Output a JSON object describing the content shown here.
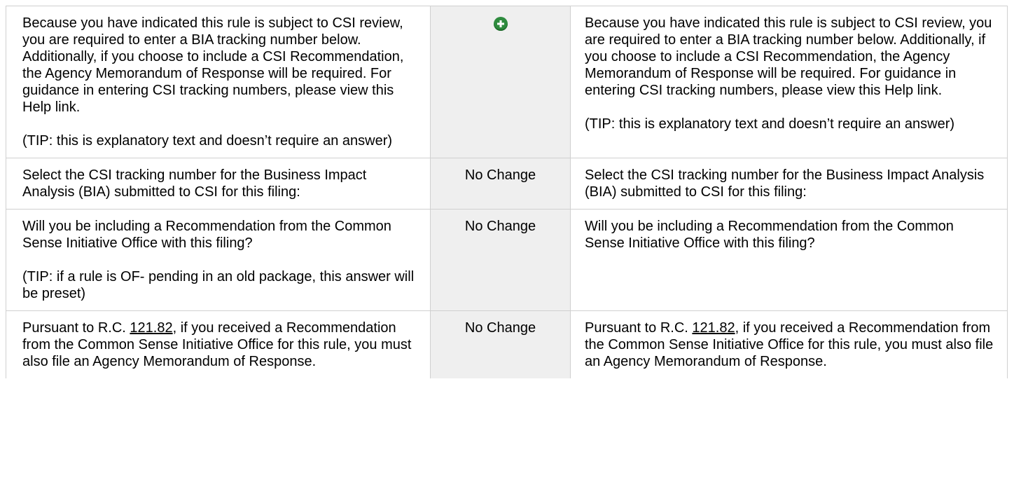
{
  "rows": [
    {
      "before": {
        "paragraphs": [
          "Because you have indicated this rule is subject to CSI review, you are required to enter a BIA tracking number below. Additionally, if you choose to include a CSI Recommendation, the Agency Memorandum of Response will be required. For guidance in entering CSI tracking numbers, please view this Help link.",
          "(TIP: this is explanatory text and doesn’t require an answer)"
        ]
      },
      "change": {
        "type": "icon",
        "icon": "plus-circle-icon",
        "color": "#2e8b3e"
      },
      "after": {
        "paragraphs": [
          "Because you have indicated this rule is subject to CSI review, you are required to enter a BIA tracking number below. Additionally, if you choose to include a CSI Recommendation, the Agency Memorandum of Response will be required. For guidance in entering CSI tracking numbers, please view this Help link.",
          "(TIP: this is explanatory text and doesn’t require an answer)"
        ]
      }
    },
    {
      "before": {
        "paragraphs": [
          "Select the CSI tracking number for the Business Impact Analysis (BIA) submitted to CSI for this filing:"
        ]
      },
      "change": {
        "type": "text",
        "label": "No Change"
      },
      "after": {
        "paragraphs": [
          "Select the CSI tracking number for the Business Impact Analysis (BIA) submitted to CSI for this filing:"
        ]
      }
    },
    {
      "before": {
        "paragraphs": [
          "Will you be including a Recommendation from the Common Sense Initiative Office with this filing?",
          "(TIP: if a rule is OF- pending in an old package, this answer will be preset)"
        ]
      },
      "change": {
        "type": "text",
        "label": "No Change"
      },
      "after": {
        "paragraphs": [
          "Will you be including a Recommendation from the Common Sense Initiative Office with this filing?"
        ]
      }
    },
    {
      "before": {
        "prefix": "Pursuant to R.C. ",
        "link": "121.82",
        "suffix": ", if you received a Recommendation from the Common Sense Initiative Office for this rule, you must also file an Agency Memorandum of Response."
      },
      "change": {
        "type": "text",
        "label": "No Change"
      },
      "after": {
        "prefix": "Pursuant to R.C. ",
        "link": "121.82",
        "suffix": ", if you received a Recommendation from the Common Sense Initiative Office for this rule, you must also file an Agency Memorandum of Response."
      }
    }
  ]
}
